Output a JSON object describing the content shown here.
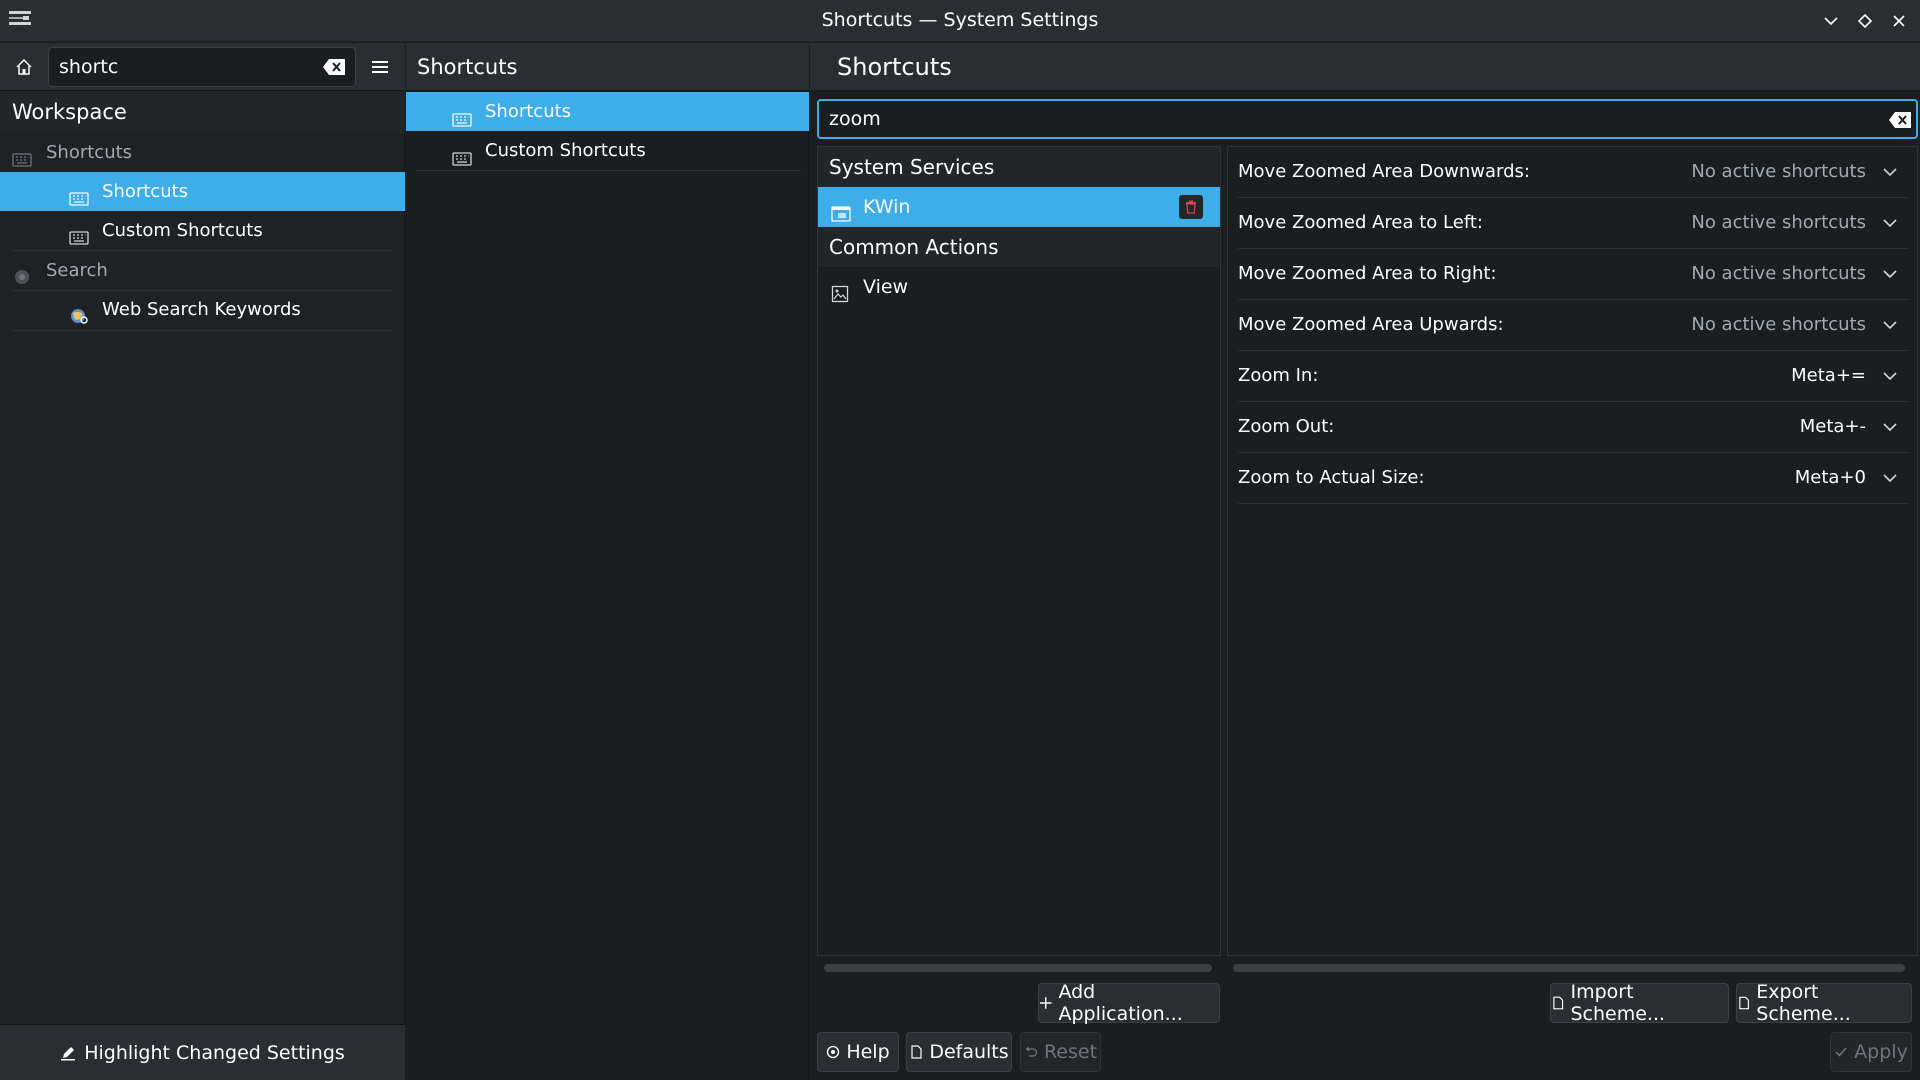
{
  "window": {
    "title": "Shortcuts — System Settings"
  },
  "sidebar": {
    "search_value": "shortc",
    "category": "Workspace",
    "items": [
      {
        "label": "Shortcuts",
        "icon": "keyboard-icon"
      },
      {
        "label": "Shortcuts",
        "icon": "keyboard-icon"
      },
      {
        "label": "Custom Shortcuts",
        "icon": "keyboard-icon"
      },
      {
        "label": "Search",
        "icon": "search-globe-icon"
      },
      {
        "label": "Web Search Keywords",
        "icon": "web-search-icon"
      }
    ],
    "footer_label": "Highlight Changed Settings"
  },
  "middle": {
    "title": "Shortcuts",
    "items": [
      {
        "label": "Shortcuts"
      },
      {
        "label": "Custom Shortcuts"
      }
    ]
  },
  "main": {
    "title": "Shortcuts",
    "search_value": "zoom",
    "groups": [
      {
        "label": "System Services"
      },
      {
        "label": "Common Actions"
      }
    ],
    "apps": [
      {
        "label": "KWin"
      },
      {
        "label": "View"
      }
    ],
    "shortcuts": [
      {
        "name": "Move Zoomed Area Downwards:",
        "value": "No active shortcuts"
      },
      {
        "name": "Move Zoomed Area to Left:",
        "value": "No active shortcuts"
      },
      {
        "name": "Move Zoomed Area to Right:",
        "value": "No active shortcuts"
      },
      {
        "name": "Move Zoomed Area Upwards:",
        "value": "No active shortcuts"
      },
      {
        "name": "Zoom In:",
        "value": "Meta+="
      },
      {
        "name": "Zoom Out:",
        "value": "Meta+-"
      },
      {
        "name": "Zoom to Actual Size:",
        "value": "Meta+0"
      }
    ],
    "buttons": {
      "add_application": "Add Application...",
      "import_scheme": "Import Scheme...",
      "export_scheme": "Export Scheme..."
    }
  },
  "footer": {
    "help": "Help",
    "defaults": "Defaults",
    "reset": "Reset",
    "apply": "Apply"
  },
  "colors": {
    "accent": "#3daee9",
    "background": "#1b1e20",
    "header": "#2a2e32"
  }
}
